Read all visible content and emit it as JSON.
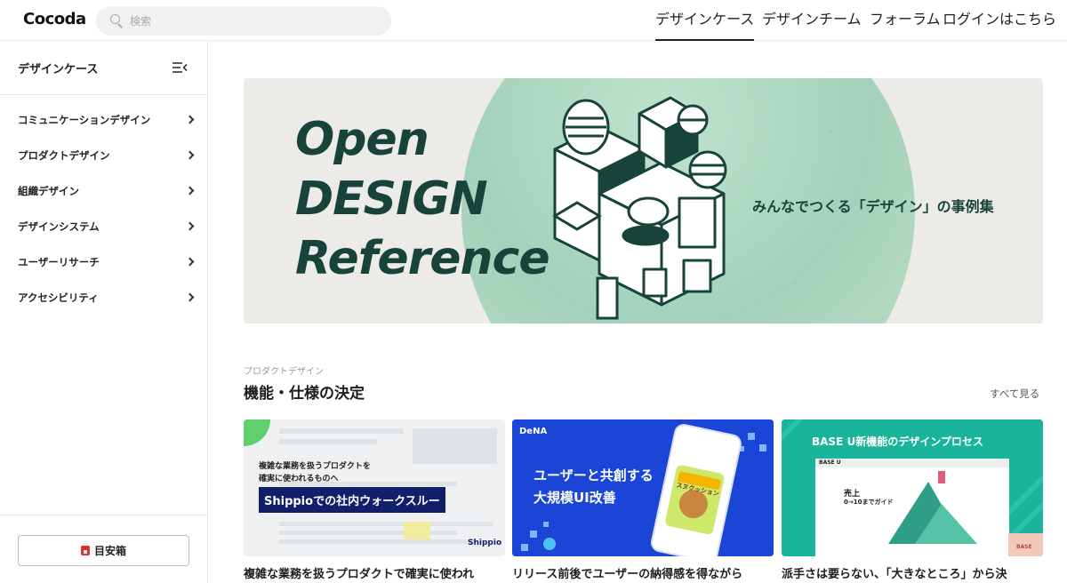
{
  "header": {
    "logo": "Cocoda",
    "search_placeholder": "検索",
    "nav": [
      "デザインケース",
      "デザインチーム",
      "フォーラム",
      "ログインはこちら"
    ],
    "active_nav": "デザインケース"
  },
  "sidebar": {
    "title": "デザインケース",
    "items": [
      {
        "label": "コミュニケーションデザイン"
      },
      {
        "label": "プロダクトデザイン"
      },
      {
        "label": "組織デザイン"
      },
      {
        "label": "デザインシステム"
      },
      {
        "label": "ユーザーリサーチ"
      },
      {
        "label": "アクセシビリティ"
      }
    ],
    "footer_button": "目安箱"
  },
  "hero": {
    "title_lines": [
      "Open",
      "DESIGN",
      "Reference"
    ],
    "tagline": "みんなでつくる「デザイン」の事例集"
  },
  "section": {
    "subtitle": "プロダクトデザイン",
    "title": "機能・仕様の決定",
    "see_all": "すべて見る"
  },
  "cards": [
    {
      "thumb_text_small_1": "複雑な業務を扱うプロダクトを",
      "thumb_text_small_2": "確実に使われるものへ",
      "thumb_text_main": "Shippioでの社内ウォークスルー",
      "thumb_brand": "Shippio",
      "title": "複雑な業務を扱うプロダクトで確実に使われ"
    },
    {
      "thumb_brand": "DeNA",
      "thumb_text_1": "ユーザーと共創する",
      "thumb_text_2": "大規模UI改善",
      "thumb_badge": "スヌクッション",
      "title": "リリース前後でユーザーの納得感を得ながら"
    },
    {
      "thumb_text_main": "BASE U新機能のデザインプロセス",
      "thumb_browser_brand": "BASE U",
      "thumb_inner_1": "売上",
      "thumb_inner_2": "0→10までガイド",
      "thumb_corner": "BASE",
      "title": "派手さは要らない、「大きなところ」から決"
    }
  ],
  "colors": {
    "hero_text": "#17433b",
    "card_blue": "#1b45d6",
    "card_teal": "#19b49a"
  }
}
